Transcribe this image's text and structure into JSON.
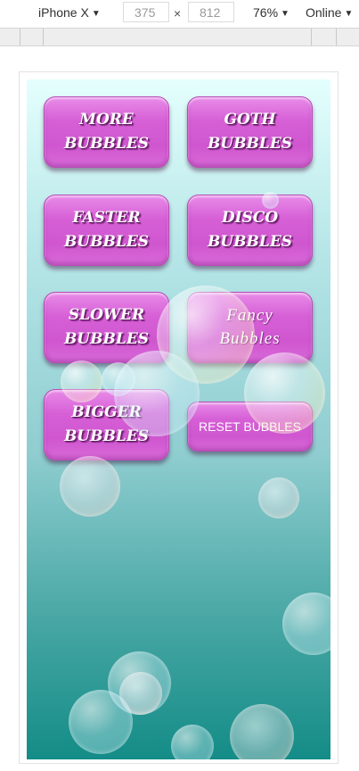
{
  "toolbar": {
    "device": "iPhone X",
    "width": "375",
    "height": "812",
    "times": "×",
    "zoom": "76%",
    "network": "Online",
    "caret": "▼"
  },
  "buttons": {
    "more": [
      "MORE",
      "BUBBLES"
    ],
    "goth": [
      "GOTH",
      "BUBBLES"
    ],
    "faster": [
      "FASTER",
      "BUBBLES"
    ],
    "disco": [
      "DISCO",
      "BUBBLES"
    ],
    "slower": [
      "SLOWER",
      "BUBBLES"
    ],
    "fancy": [
      "Fancy",
      "Bubbles"
    ],
    "bigger": [
      "BIGGER",
      "BUBBLES"
    ],
    "reset": "RESET BUBBLES"
  },
  "colors": {
    "button": "#d65fd6",
    "background_top": "#e4fffd",
    "background_bottom": "#148c87"
  }
}
